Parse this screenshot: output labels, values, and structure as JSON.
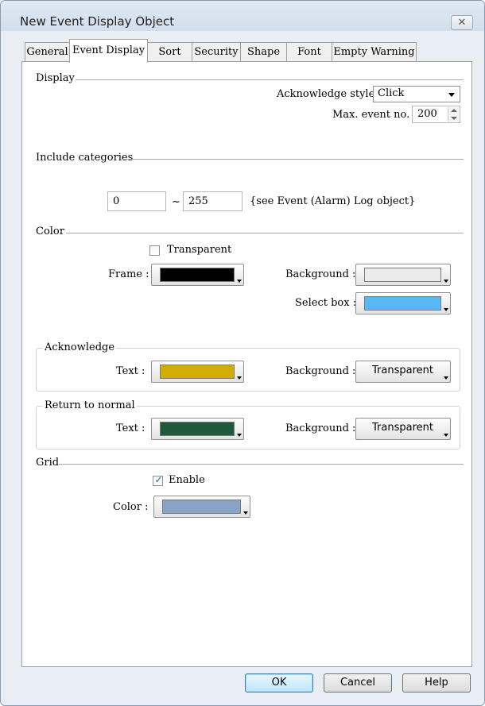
{
  "window": {
    "title": "New Event Display Object",
    "close_glyph": "✕"
  },
  "tabs": [
    {
      "label": "General"
    },
    {
      "label": "Event Display"
    },
    {
      "label": "Sort"
    },
    {
      "label": "Security"
    },
    {
      "label": "Shape"
    },
    {
      "label": "Font"
    },
    {
      "label": "Empty Warning"
    }
  ],
  "active_tab": "Event Display",
  "display": {
    "section_label": "Display",
    "ack_style_label": "Acknowledge style :",
    "ack_style_value": "Click",
    "max_event_label": "Max. event no. :",
    "max_event_value": "200"
  },
  "categories": {
    "section_label": "Include categories",
    "from_value": "0",
    "separator": "~",
    "to_value": "255",
    "note": "{see Event (Alarm) Log object}"
  },
  "color": {
    "section_label": "Color",
    "transparent_label": "Transparent",
    "transparent_checked": false,
    "frame_label": "Frame :",
    "frame_color": "#000000",
    "background_label": "Background :",
    "background_color": "#ebebeb",
    "select_box_label": "Select box :",
    "select_box_color": "#59b8f5"
  },
  "acknowledge": {
    "group_label": "Acknowledge",
    "text_label": "Text :",
    "text_color": "#d2ad07",
    "background_label": "Background :",
    "background_value": "Transparent"
  },
  "return_to_normal": {
    "group_label": "Return to normal",
    "text_label": "Text :",
    "text_color": "#1f583a",
    "background_label": "Background :",
    "background_value": "Transparent"
  },
  "grid": {
    "section_label": "Grid",
    "enable_label": "Enable",
    "enable_checked": true,
    "color_label": "Color :",
    "color": "#89a3c6"
  },
  "buttons": {
    "ok": "OK",
    "cancel": "Cancel",
    "help": "Help"
  }
}
